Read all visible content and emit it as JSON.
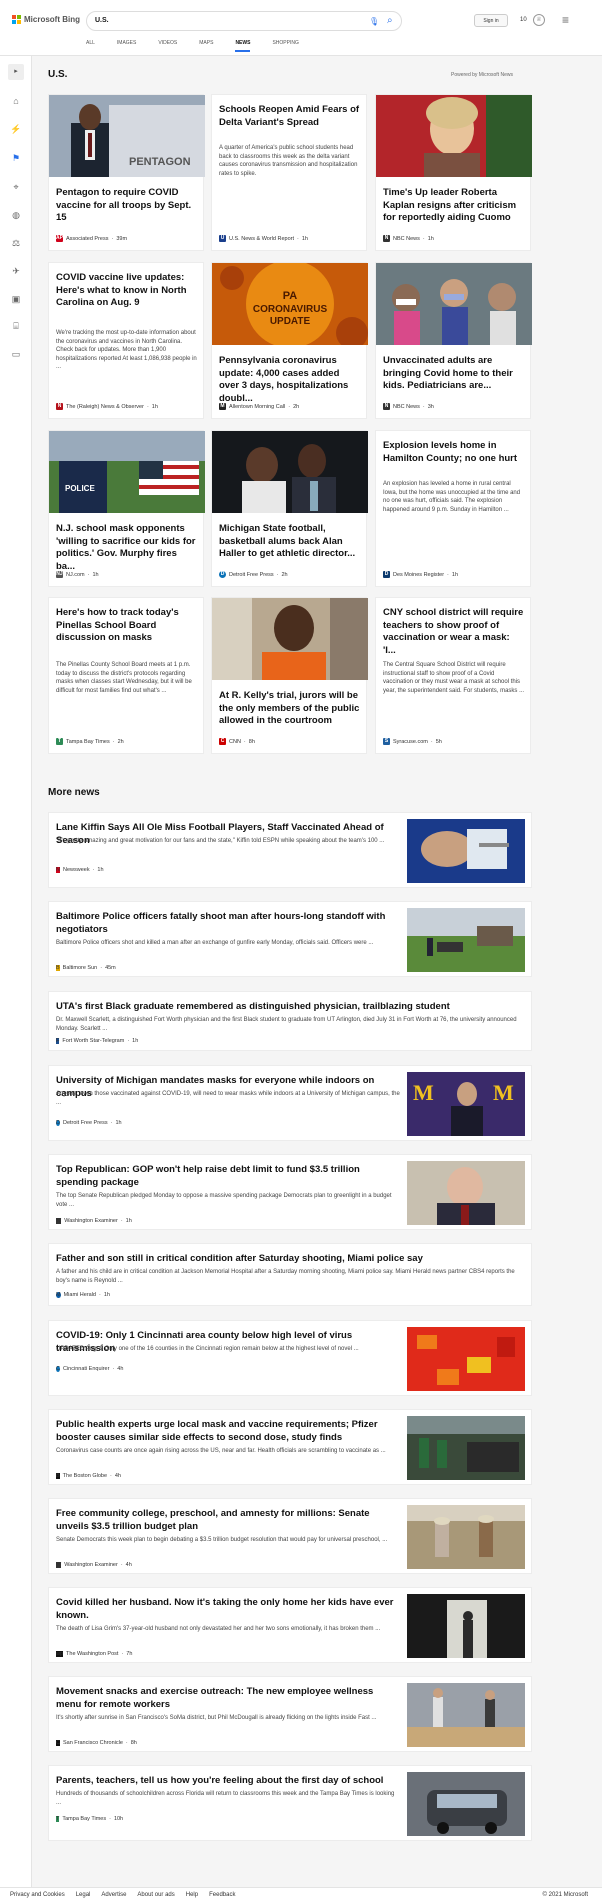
{
  "header": {
    "logo_text": "Microsoft Bing",
    "search_value": "U.S.",
    "sign_in": "Sign in",
    "points": "10",
    "tabs": [
      "ALL",
      "IMAGES",
      "VIDEOS",
      "MAPS",
      "NEWS",
      "SHOPPING"
    ],
    "active_tab": "NEWS"
  },
  "section": {
    "title": "U.S.",
    "powered": "Powered by Microsoft News"
  },
  "cards": [
    {
      "title": "Pentagon to require COVID vaccine for all troops by Sept. 15",
      "summary": "",
      "source": "Associated Press",
      "time": "39m",
      "logo": "AP",
      "logo_color": "#d0021b"
    },
    {
      "title": "Schools Reopen Amid Fears of Delta Variant's Spread",
      "summary": "A quarter of America's public school students head back to classrooms this week as the delta variant causes coronavirus transmission and hospitalization rates to spike.",
      "source": "U.S. News & World Report",
      "time": "1h",
      "logo": "U",
      "logo_color": "#1a3e8c"
    },
    {
      "title": "Time's Up leader Roberta Kaplan resigns after criticism for reportedly aiding Cuomo",
      "summary": "",
      "source": "NBC News",
      "time": "1h",
      "logo": "N",
      "logo_color": "#333333"
    },
    {
      "title": "COVID vaccine live updates: Here's what to know in North Carolina on Aug. 9",
      "summary": "We're tracking the most up-to-date information about the coronavirus and vaccines in North Carolina. Check back for updates. More than 1,900 hospitalizations reported At least 1,086,938 people in ...",
      "source": "The (Raleigh) News & Observer",
      "time": "1h",
      "logo": "N",
      "logo_color": "#b5121b"
    },
    {
      "title": "Pennsylvania coronavirus update: 4,000 cases added over 3 days, hospitalizations doubl...",
      "summary": "",
      "source": "Allentown Morning Call",
      "time": "2h",
      "logo": "M",
      "logo_color": "#222222"
    },
    {
      "title": "Unvaccinated adults are bringing Covid home to their kids. Pediatricians are...",
      "summary": "",
      "source": "NBC News",
      "time": "3h",
      "logo": "N",
      "logo_color": "#333333"
    },
    {
      "title": "N.J. school mask opponents 'willing to sacrifice our kids for politics.' Gov. Murphy fires ba...",
      "summary": "",
      "source": "NJ.com",
      "time": "1h",
      "logo": "NJ",
      "logo_color": "#555555"
    },
    {
      "title": "Michigan State football, basketball alums back Alan Haller to get athletic director...",
      "summary": "",
      "source": "Detroit Free Press",
      "time": "2h",
      "logo": "D",
      "logo_color": "#0a72b8"
    },
    {
      "title": "Explosion levels home in Hamilton County; no one hurt",
      "summary": "An explosion has leveled a home in rural central Iowa, but the home was unoccupied at the time and no one was hurt, officials said. The explosion happened around 9 p.m. Sunday in Hamilton ...",
      "source": "Des Moines Register",
      "time": "1h",
      "logo": "D",
      "logo_color": "#0b3a6e"
    },
    {
      "title": "Here's how to track today's Pinellas School Board discussion on masks",
      "summary": "The Pinellas County School Board meets at 1 p.m. today to discuss the district's protocols regarding masks when classes start Wednesday, but it will be difficult for most families find out what's ...",
      "source": "Tampa Bay Times",
      "time": "2h",
      "logo": "T",
      "logo_color": "#2e8b57"
    },
    {
      "title": "At R. Kelly's trial, jurors will be the only members of the public allowed in the courtroom",
      "summary": "",
      "source": "CNN",
      "time": "8h",
      "logo": "C",
      "logo_color": "#cc0000"
    },
    {
      "title": "CNY school district will require teachers to show proof of vaccination or wear a mask: 'I...",
      "summary": "The Central Square School District will require instructional staff to show proof of a Covid vaccination or they must wear a mask at school this year, the superintendent said. For students, masks ...",
      "source": "Syracuse.com",
      "time": "5h",
      "logo": "S",
      "logo_color": "#1f5fa0"
    }
  ],
  "more_news_title": "More news",
  "more_news": [
    {
      "title": "Lane Kiffin Says All Ole Miss Football Players, Staff Vaccinated Ahead of Season",
      "summary": "\"It's pretty amazing and great motivation for our fans and the state,\" Kiffin told ESPN while speaking about the team's 100 ...",
      "source": "Newsweek",
      "time": "1h",
      "logo": "N",
      "logo_color": "#d0021b",
      "has_image": true
    },
    {
      "title": "Baltimore Police officers fatally shoot man after hours-long standoff with negotiators",
      "summary": "Baltimore Police officers shot and killed a man after an exchange of gunfire early Monday, officials said. Officers were ...",
      "source": "Baltimore Sun",
      "time": "45m",
      "logo": "B",
      "logo_color": "#e0a800",
      "has_image": true
    },
    {
      "title": "UTA's first Black graduate remembered as distinguished physician, trailblazing student",
      "summary": "Dr. Maxwell Scarlett, a distinguished Fort Worth physician and the first Black student to graduate from UT Arlington, died July 31 in Fort Worth at 76, the university announced Monday. Scarlett ...",
      "source": "Fort Worth Star-Telegram",
      "time": "1h",
      "logo": "F",
      "logo_color": "#1c4d8c",
      "has_image": false
    },
    {
      "title": "University of Michigan mandates masks for everyone while indoors on campus",
      "summary": "Anyone, even those vaccinated against COVID-19, will need to wear masks while indoors at a University of Michigan campus, the ...",
      "source": "Detroit Free Press",
      "time": "1h",
      "logo": "D",
      "logo_color": "#0a72b8",
      "has_image": true
    },
    {
      "title": "Top Republican: GOP won't help raise debt limit to fund $3.5 trillion spending package",
      "summary": "The top Senate Republican pledged Monday to oppose a massive spending package Democrats plan to greenlight in a budget vote ...",
      "source": "Washington Examiner",
      "time": "1h",
      "logo": "W",
      "logo_color": "#333333",
      "has_image": true
    },
    {
      "title": "Father and son still in critical condition after Saturday shooting, Miami police say",
      "summary": "A father and his child are in critical condition at Jackson Memorial Hospital after a Saturday morning shooting, Miami police say. Miami Herald news partner CBS4 reports the boy's name is Reynold ...",
      "source": "Miami Herald",
      "time": "1h",
      "logo": "M",
      "logo_color": "#0a5ca8",
      "has_image": false
    },
    {
      "title": "COVID-19: Only 1 Cincinnati area county below high level of virus transmission",
      "summary": "UPDATED Aug. 9 Only one of the 16 counties in the Cincinnati region remain below at the highest level of novel ...",
      "source": "Cincinnati Enquirer",
      "time": "4h",
      "logo": "C",
      "logo_color": "#0a72b8",
      "has_image": true
    },
    {
      "title": "Public health experts urge local mask and vaccine requirements; Pfizer booster causes similar side effects to second dose, study finds",
      "summary": "Coronavirus case counts are once again rising across the US, near and far. Health officials are scrambling to vaccinate as ...",
      "source": "The Boston Globe",
      "time": "4h",
      "logo": "B",
      "logo_color": "#111111",
      "has_image": true
    },
    {
      "title": "Free community college, preschool, and amnesty for millions: Senate unveils $3.5 trillion budget plan",
      "summary": "Senate Democrats this week plan to begin debating a $3.5 trillion budget resolution that would pay for universal preschool, ...",
      "source": "Washington Examiner",
      "time": "4h",
      "logo": "W",
      "logo_color": "#333333",
      "has_image": true
    },
    {
      "title": "Covid killed her husband. Now it's taking the only home her kids have ever known.",
      "summary": "The death of Lisa Grim's 37-year-old husband not only devastated her and her two sons emotionally, it has broken them ...",
      "source": "The Washington Post",
      "time": "7h",
      "logo": "wp",
      "logo_color": "#111111",
      "has_image": true
    },
    {
      "title": "Movement snacks and exercise outreach: The new employee wellness menu for remote workers",
      "summary": "It's shortly after sunrise in San Francisco's SoMa district, but Phil McDougall is already flicking on the lights inside Fast ...",
      "source": "San Francisco Chronicle",
      "time": "8h",
      "logo": "C",
      "logo_color": "#111111",
      "has_image": true
    },
    {
      "title": "Parents, teachers, tell us how you're feeling about the first day of school",
      "summary": "Hundreds of thousands of schoolchildren across Florida will return to classrooms this week and the Tampa Bay Times is looking ...",
      "source": "Tampa Bay Times",
      "time": "10h",
      "logo": "T",
      "logo_color": "#2e8b57",
      "has_image": true
    }
  ],
  "footer": {
    "links": [
      "Privacy and Cookies",
      "Legal",
      "Advertise",
      "About our ads",
      "Help",
      "Feedback"
    ],
    "copyright": "© 2021 Microsoft"
  }
}
